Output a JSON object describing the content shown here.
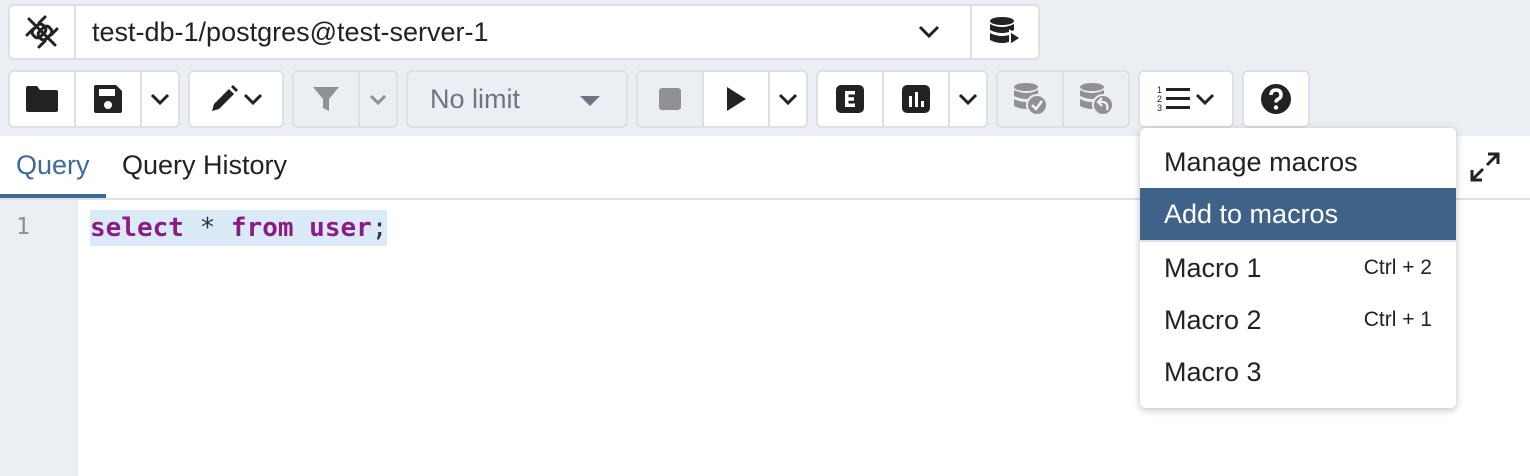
{
  "connection": {
    "label": "test-db-1/postgres@test-server-1"
  },
  "toolbar": {
    "limit_value": "No limit"
  },
  "tabs": [
    {
      "label": "Query"
    },
    {
      "label": "Query History"
    }
  ],
  "editor": {
    "line_number": "1",
    "tokens": [
      "select",
      "*",
      "from",
      "user",
      ";"
    ]
  },
  "macro_menu": {
    "manage": "Manage macros",
    "add": "Add to macros",
    "macros": [
      {
        "label": "Macro 1",
        "shortcut": "Ctrl + 2"
      },
      {
        "label": "Macro 2",
        "shortcut": "Ctrl + 1"
      },
      {
        "label": "Macro 3",
        "shortcut": ""
      }
    ]
  },
  "colors": {
    "accent": "#3d6a9a",
    "menu_active": "#3f6289",
    "keyword": "#8e1a84",
    "selection": "#dbeaf7"
  },
  "icons": [
    "disconnected-plug-icon",
    "chevron-down-icon",
    "database-execute-icon",
    "folder-icon",
    "save-icon",
    "pencil-icon",
    "filter-icon",
    "stop-icon",
    "play-icon",
    "explain-icon",
    "explain-analyze-icon",
    "commit-icon",
    "rollback-icon",
    "macros-list-icon",
    "help-icon",
    "expand-icon"
  ]
}
